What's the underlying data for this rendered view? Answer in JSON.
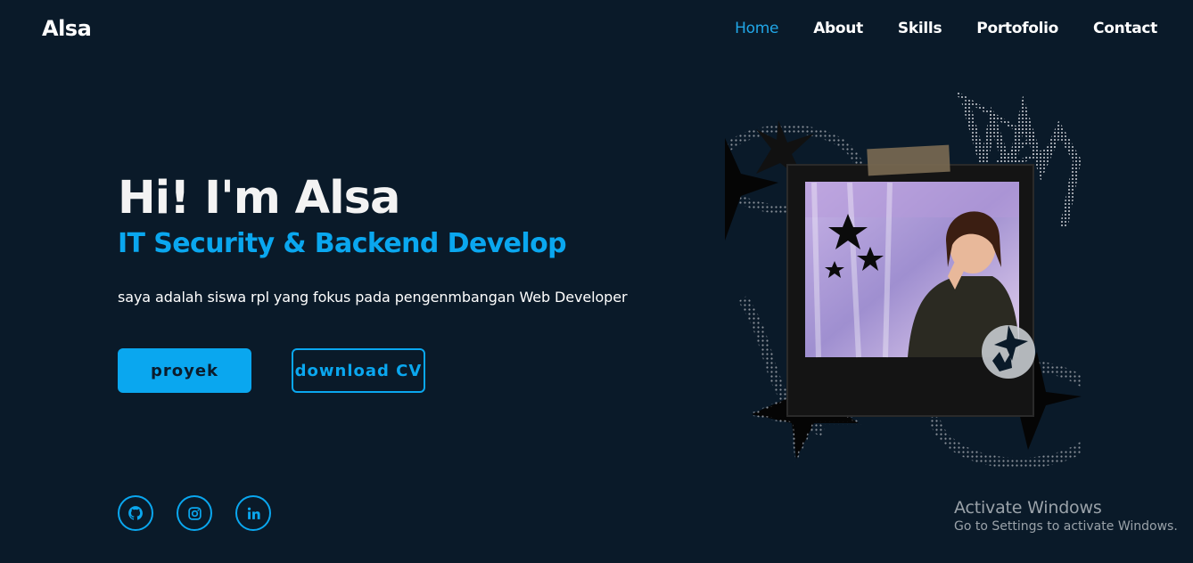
{
  "brand": {
    "logo": "Alsa"
  },
  "nav": {
    "items": [
      {
        "label": "Home",
        "active": true
      },
      {
        "label": "About",
        "active": false
      },
      {
        "label": "Skills",
        "active": false
      },
      {
        "label": "Portofolio",
        "active": false
      },
      {
        "label": "Contact",
        "active": false
      }
    ]
  },
  "hero": {
    "title": "Hi! I'm Alsa",
    "subtitle": "IT Security & Backend Develop",
    "description": "saya adalah siswa rpl yang fokus pada pengenmbangan Web Developer",
    "primary_button": "proyek",
    "secondary_button": "download CV"
  },
  "social": [
    {
      "icon": "github-icon"
    },
    {
      "icon": "instagram-icon"
    },
    {
      "icon": "linkedin-icon"
    }
  ],
  "watermark": {
    "line1": "Activate Windows",
    "line2": "Go to Settings to activate Windows."
  },
  "colors": {
    "background": "#0a1a29",
    "accent": "#0aa7ef",
    "nav_active": "#21a6e6"
  }
}
